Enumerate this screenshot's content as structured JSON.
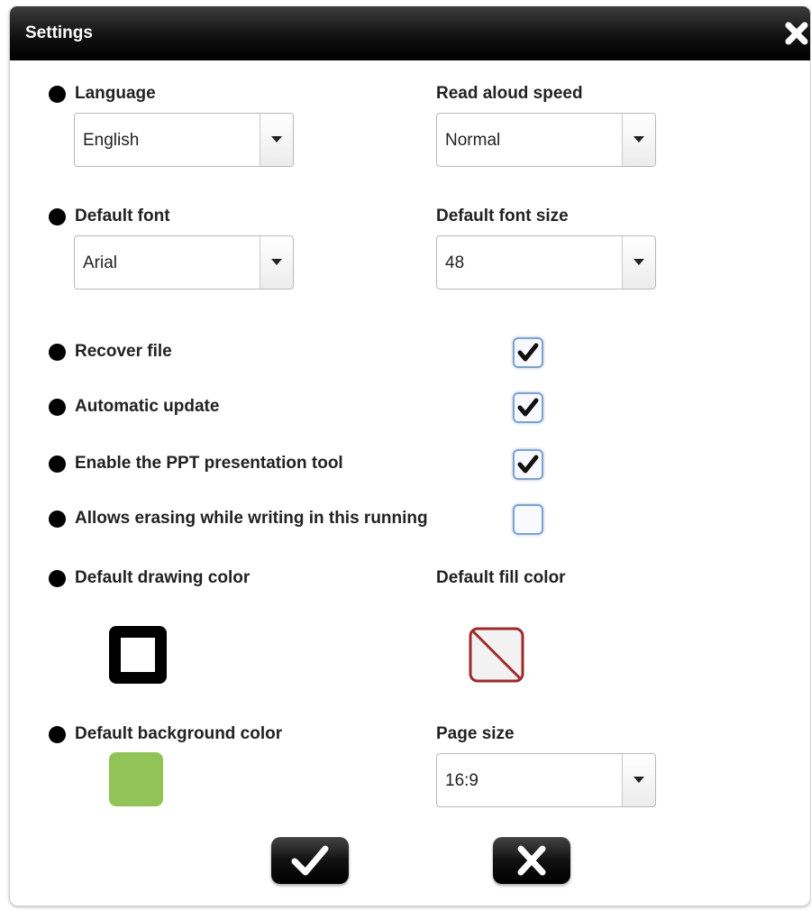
{
  "dialog": {
    "title": "Settings",
    "close_icon": "close-icon"
  },
  "language": {
    "label": "Language",
    "value": "English"
  },
  "read_aloud_speed": {
    "label": "Read aloud speed",
    "value": "Normal"
  },
  "default_font": {
    "label": "Default font",
    "value": "Arial"
  },
  "default_font_size": {
    "label": "Default font size",
    "value": "48"
  },
  "options": [
    {
      "label": "Recover file",
      "checked": true
    },
    {
      "label": "Automatic update",
      "checked": true
    },
    {
      "label": "Enable the PPT presentation tool",
      "checked": true
    },
    {
      "label": "Allows erasing while writing in this running",
      "checked": false
    }
  ],
  "drawing_color": {
    "label": "Default drawing color",
    "color": "#000000"
  },
  "fill_color": {
    "label": "Default fill color",
    "color": "none",
    "border_color": "#9e2a2b"
  },
  "background_color": {
    "label": "Default background color",
    "color": "#92c357"
  },
  "page_size": {
    "label": "Page size",
    "value": "16:9"
  },
  "buttons": {
    "ok_icon": "check-icon",
    "cancel_icon": "cancel-icon"
  }
}
